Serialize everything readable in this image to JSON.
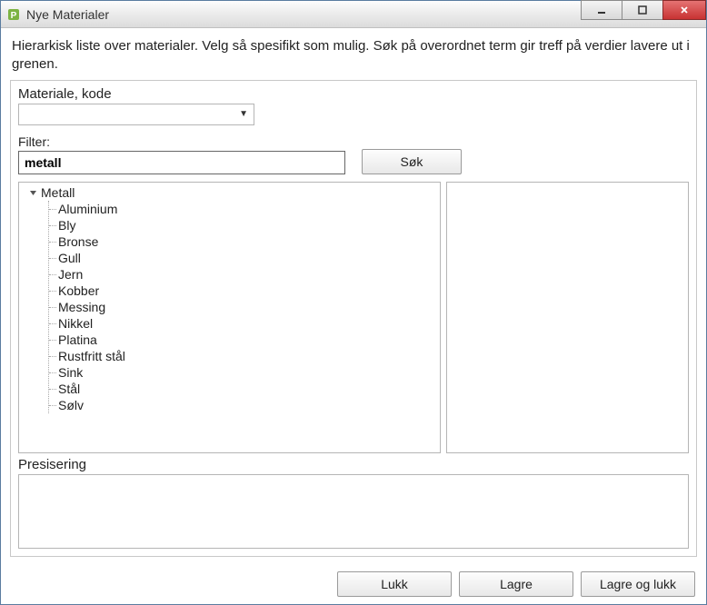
{
  "window": {
    "title": "Nye Materialer"
  },
  "instructions": "Hierarkisk liste over materialer. Velg så spesifikt som mulig. Søk på overordnet term gir treff på verdier lavere ut i grenen.",
  "materiale_kode": {
    "label": "Materiale, kode",
    "value": ""
  },
  "filter": {
    "label": "Filter:",
    "value": "metall"
  },
  "buttons": {
    "search": "Søk",
    "close": "Lukk",
    "save": "Lagre",
    "save_and_close": "Lagre og lukk"
  },
  "tree": {
    "root_label": "Metall",
    "expanded": true,
    "children": [
      "Aluminium",
      "Bly",
      "Bronse",
      "Gull",
      "Jern",
      "Kobber",
      "Messing",
      "Nikkel",
      "Platina",
      "Rustfritt stål",
      "Sink",
      "Stål",
      "Sølv"
    ]
  },
  "presisering": {
    "label": "Presisering",
    "value": ""
  }
}
